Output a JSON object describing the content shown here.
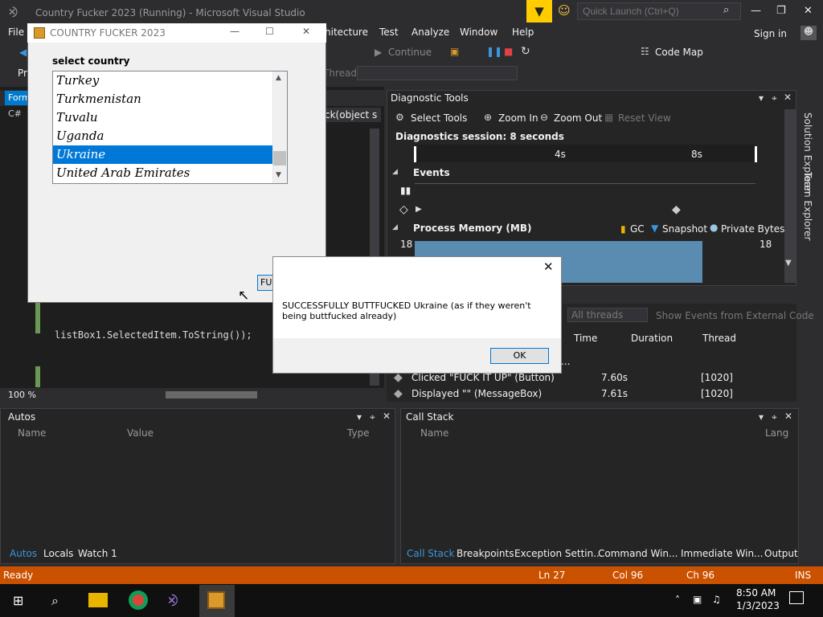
{
  "vs": {
    "title": "Country Fucker 2023 (Running) - Microsoft Visual Studio",
    "quick_launch_placeholder": "Quick Launch (Ctrl+Q)",
    "menu": [
      "File",
      "hitecture",
      "Test",
      "Analyze",
      "Window",
      "Help"
    ],
    "sign_in": "Sign in",
    "toolbar": {
      "continue": "Continue",
      "code_map": "Code Map",
      "pr": "Pr",
      "thread_label": "Thread:"
    },
    "editor": {
      "form_tab": "Form",
      "c_tab": "C#",
      "method": "ck(object s",
      "code_line": "listBox1.SelectedItem.ToString());",
      "zoom": "100 %"
    }
  },
  "diagnostic": {
    "title": "Diagnostic Tools",
    "select_tools": "Select Tools",
    "zoom_in": "Zoom In",
    "zoom_out": "Zoom Out",
    "reset_view": "Reset View",
    "session": "Diagnostics session: 8 seconds",
    "tick_4s": "4s",
    "tick_8s": "8s",
    "events_label": "Events",
    "process_memory": "Process Memory (MB)",
    "gc": "GC",
    "snapshot": "Snapshot",
    "private_bytes": "Private Bytes",
    "mem_max_left": "18",
    "mem_max_right": "18",
    "all_threads": "All threads",
    "show_external": "Show Events from External Code",
    "columns": {
      "time": "Time",
      "duration": "Duration",
      "thread": "Thread"
    },
    "ellipsis": "...",
    "events": [
      {
        "name": "Clicked \"FUCK IT UP\" (Button)",
        "time": "7.60s",
        "thread": "[1020]"
      },
      {
        "name": "Displayed \"\" (MessageBox)",
        "time": "7.61s",
        "thread": "[1020]"
      }
    ]
  },
  "autos": {
    "title": "Autos",
    "columns": {
      "name": "Name",
      "value": "Value",
      "type": "Type"
    },
    "tabs": [
      "Autos",
      "Locals",
      "Watch 1"
    ]
  },
  "callstack": {
    "title": "Call Stack",
    "columns": {
      "name": "Name",
      "lang": "Lang"
    },
    "tabs": [
      "Call Stack",
      "Breakpoints",
      "Exception Settin...",
      "Command Win...",
      "Immediate Win...",
      "Output"
    ]
  },
  "side_tabs": [
    "Solution Explorer",
    "Team Explorer"
  ],
  "status": {
    "ready": "Ready",
    "ln": "Ln 27",
    "col": "Col 96",
    "ch": "Ch 96",
    "ins": "INS"
  },
  "taskbar": {
    "time": "8:50 AM",
    "date": "1/3/2023"
  },
  "form": {
    "title": "COUNTRY FUCKER 2023",
    "select_label": "select country",
    "countries": [
      "Turkey",
      "Turkmenistan",
      "Tuvalu",
      "Uganda",
      "Ukraine",
      "United Arab Emirates"
    ],
    "selected": "Ukraine",
    "button_partial": "FU"
  },
  "msgbox": {
    "text": "SUCCESSFULLY BUTTFUCKED Ukraine (as if they weren't being buttfucked already)",
    "ok": "OK"
  },
  "colors": {
    "vs_bg": "#2d2d30",
    "accent": "#007acc",
    "status_bar": "#ca5100",
    "selection": "#0078d7"
  }
}
